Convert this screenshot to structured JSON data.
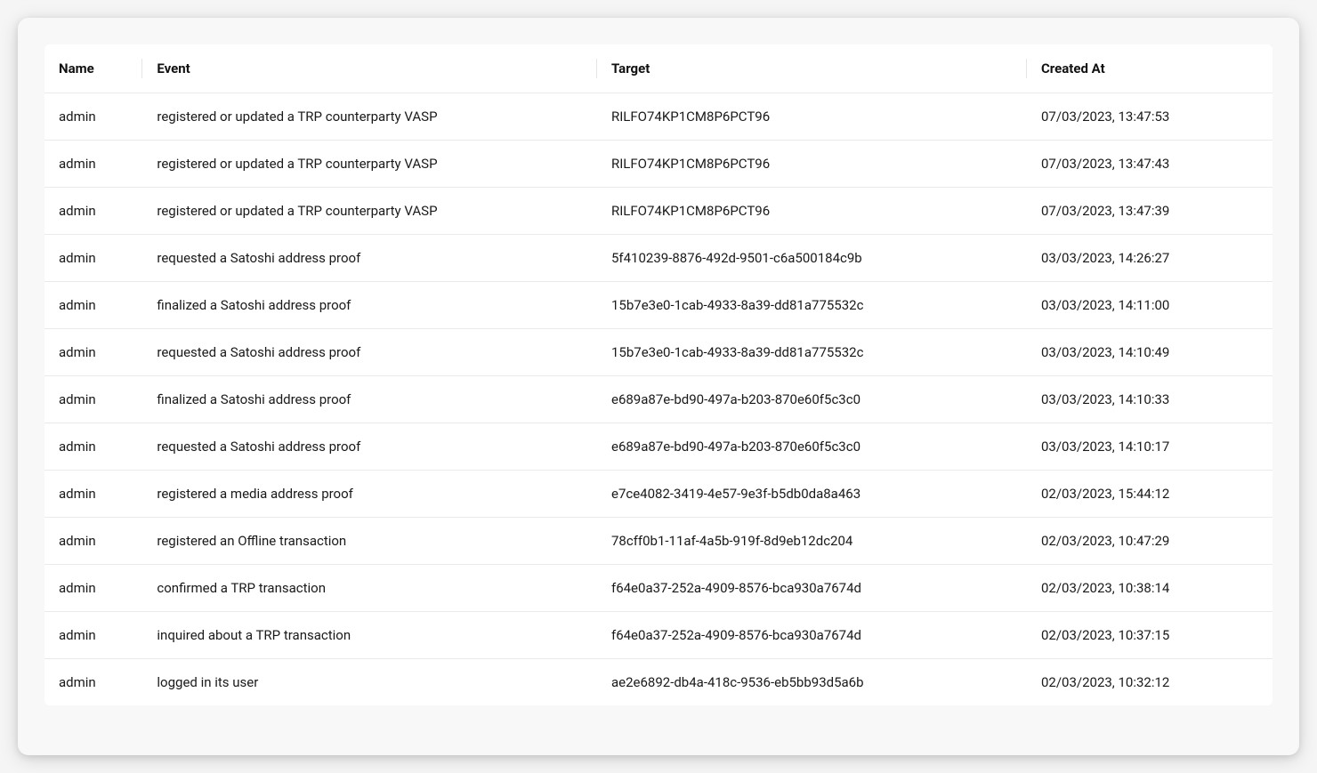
{
  "table": {
    "headers": {
      "name": "Name",
      "event": "Event",
      "target": "Target",
      "created_at": "Created At"
    },
    "rows": [
      {
        "name": "admin",
        "event": "registered or updated a TRP counterparty VASP",
        "target": "RILFO74KP1CM8P6PCT96",
        "created_at": "07/03/2023, 13:47:53"
      },
      {
        "name": "admin",
        "event": "registered or updated a TRP counterparty VASP",
        "target": "RILFO74KP1CM8P6PCT96",
        "created_at": "07/03/2023, 13:47:43"
      },
      {
        "name": "admin",
        "event": "registered or updated a TRP counterparty VASP",
        "target": "RILFO74KP1CM8P6PCT96",
        "created_at": "07/03/2023, 13:47:39"
      },
      {
        "name": "admin",
        "event": "requested a Satoshi address proof",
        "target": "5f410239-8876-492d-9501-c6a500184c9b",
        "created_at": "03/03/2023, 14:26:27"
      },
      {
        "name": "admin",
        "event": "finalized a Satoshi address proof",
        "target": "15b7e3e0-1cab-4933-8a39-dd81a775532c",
        "created_at": "03/03/2023, 14:11:00"
      },
      {
        "name": "admin",
        "event": "requested a Satoshi address proof",
        "target": "15b7e3e0-1cab-4933-8a39-dd81a775532c",
        "created_at": "03/03/2023, 14:10:49"
      },
      {
        "name": "admin",
        "event": "finalized a Satoshi address proof",
        "target": "e689a87e-bd90-497a-b203-870e60f5c3c0",
        "created_at": "03/03/2023, 14:10:33"
      },
      {
        "name": "admin",
        "event": "requested a Satoshi address proof",
        "target": "e689a87e-bd90-497a-b203-870e60f5c3c0",
        "created_at": "03/03/2023, 14:10:17"
      },
      {
        "name": "admin",
        "event": "registered a media address proof",
        "target": "e7ce4082-3419-4e57-9e3f-b5db0da8a463",
        "created_at": "02/03/2023, 15:44:12"
      },
      {
        "name": "admin",
        "event": "registered an Offline transaction",
        "target": "78cff0b1-11af-4a5b-919f-8d9eb12dc204",
        "created_at": "02/03/2023, 10:47:29"
      },
      {
        "name": "admin",
        "event": "confirmed a TRP transaction",
        "target": "f64e0a37-252a-4909-8576-bca930a7674d",
        "created_at": "02/03/2023, 10:38:14"
      },
      {
        "name": "admin",
        "event": "inquired about a TRP transaction",
        "target": "f64e0a37-252a-4909-8576-bca930a7674d",
        "created_at": "02/03/2023, 10:37:15"
      },
      {
        "name": "admin",
        "event": "logged in its user",
        "target": "ae2e6892-db4a-418c-9536-eb5bb93d5a6b",
        "created_at": "02/03/2023, 10:32:12"
      }
    ]
  }
}
